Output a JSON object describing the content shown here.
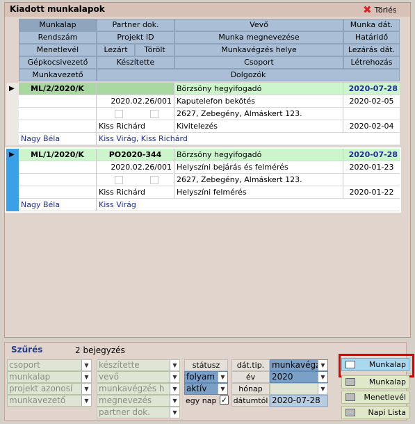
{
  "window": {
    "title": "Kiadott munkalapok",
    "delete_label": "Törlés"
  },
  "header": {
    "row1": [
      "Munkalap",
      "Partner dok.",
      "Vevő",
      "Munka dát."
    ],
    "row2": [
      "Rendszám",
      "Projekt ID",
      "Munka megnevezése",
      "Határidő"
    ],
    "row3": [
      "Menetlevél",
      "Lezárt",
      "Törölt",
      "Munkavégzés helye",
      "Lezárás dát."
    ],
    "row4": [
      "Gépkocsivezető",
      "Készítette",
      "Csoport",
      "Létrehozás"
    ],
    "row5": [
      "Munkavezető",
      "Dolgozók"
    ]
  },
  "records": [
    {
      "munkalap": "ML/2/2020/K",
      "partner_dok": "",
      "vevo": "Börzsöny hegyifogadó",
      "munka_dat": "2020-07-28",
      "projekt_id": "2020.02.26/001",
      "munka_megnevezese": "Kaputelefon bekötés",
      "hatarido": "2020-02-05",
      "munkavegzes_helye": "2627, Zebegény, Almáskert 123.",
      "keszitette": "Kiss Richárd",
      "csoport": "Kivitelezés",
      "letrehozas": "2020-02-04",
      "munkavezeto": "Nagy Béla",
      "dolgozok": "Kiss Virág, Kiss Richárd"
    },
    {
      "munkalap": "ML/1/2020/K",
      "partner_dok": "PO2020-344",
      "vevo": "Börzsöny hegyifogadó",
      "munka_dat": "2020-07-28",
      "projekt_id": "2020.02.26/001",
      "munka_megnevezese": "Helyszíni bejárás és felmérés",
      "hatarido": "2020-01-23",
      "munkavegzes_helye": "2627, Zebegény, Almáskert 123.",
      "keszitette": "Kiss Richárd",
      "csoport": "Helyszíni felmérés",
      "letrehozas": "2020-01-22",
      "munkavezeto": "Nagy Béla",
      "dolgozok": "Kiss Virág"
    }
  ],
  "filter": {
    "title": "Szűrés",
    "count": "2 bejegyzés",
    "col1": [
      "csoport",
      "munkalap",
      "projekt azonosí",
      "munkavezető"
    ],
    "col2": [
      "készítette",
      "vevő",
      "munkavégzés h",
      "megnevezés",
      "partner dok."
    ],
    "statusz_label": "státusz",
    "statusz_values": [
      "folyam",
      "aktív"
    ],
    "egy_nap_label": "egy nap",
    "dat_tip_label": "dát.tip.",
    "dat_tip_value": "munkavégzé",
    "ev_label": "év",
    "ev_value": "2020",
    "honap_label": "hónap",
    "honap_value": "",
    "datumtol_label": "dátumtól",
    "datumtol_value": "2020-07-28",
    "buttons": [
      "Munkalap",
      "Munkalap",
      "Menetlevél",
      "Napi Lista"
    ]
  },
  "colors": {
    "highlight_box": "#e00000",
    "record_green": "#a8d8a0",
    "record_light_green": "#ccf5cc",
    "selected_bar": "#3aa0e8"
  }
}
